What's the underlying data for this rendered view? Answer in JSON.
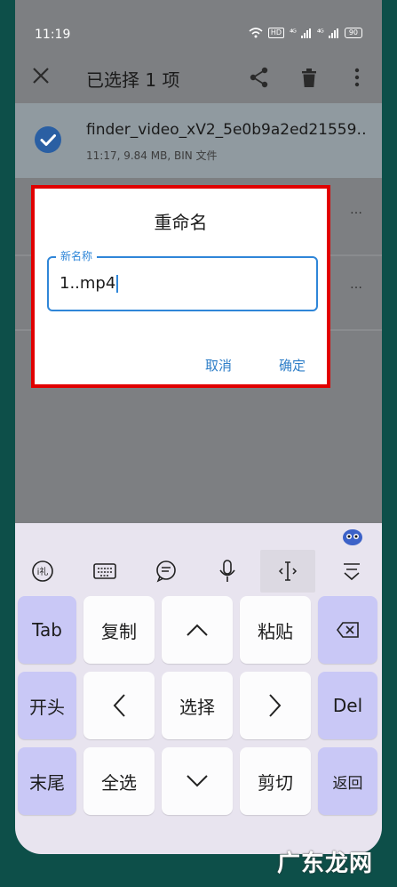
{
  "status_bar": {
    "time": "11:19",
    "hd": "HD",
    "signal1": "⁴ᴳ",
    "signal2": "⁴ᴳ",
    "battery": "90"
  },
  "app_bar": {
    "title": "已选择 1 项",
    "close_icon": "close-icon",
    "share_icon": "share-icon",
    "delete_icon": "trash-icon",
    "more_icon": "more-vertical-icon"
  },
  "file_list": {
    "items": [
      {
        "name": "finder_video_xV2_5e0b9a2ed21559…",
        "meta": "11:17, 9.84 MB, BIN 文件",
        "checked": true
      }
    ]
  },
  "rename_dialog": {
    "title": "重命名",
    "field_label": "新名称",
    "field_value": "1..mp4",
    "cancel_label": "取消",
    "confirm_label": "确定"
  },
  "keyboard": {
    "toolbar": [
      "ime-icon",
      "keyboard-icon",
      "chat-icon",
      "microphone-icon",
      "text-cursor-icon",
      "collapse-icon"
    ],
    "rows": [
      [
        "Tab",
        "复制",
        "^",
        "粘贴",
        "backspace"
      ],
      [
        "开头",
        "<",
        "选择",
        ">",
        "Del"
      ],
      [
        "末尾",
        "全选",
        "v",
        "剪切",
        "返回"
      ]
    ]
  },
  "watermark": "广东龙网",
  "colors": {
    "accent": "#2f86d8",
    "highlight_frame": "#e10000",
    "key_purple": "#c9c8f6",
    "checkbox": "#2a5fa3"
  }
}
